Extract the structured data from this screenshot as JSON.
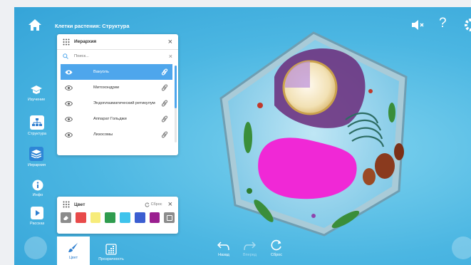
{
  "app": {
    "title": "Клетки растения: Структура"
  },
  "sidebar": {
    "items": [
      {
        "label": "Изучение",
        "icon": "graduation-cap-icon"
      },
      {
        "label": "Структура",
        "icon": "hierarchy-icon"
      },
      {
        "label": "Иерархия",
        "icon": "layers-icon"
      },
      {
        "label": "Инфо",
        "icon": "info-icon"
      },
      {
        "label": "Рассказ",
        "icon": "play-icon"
      }
    ]
  },
  "hierarchy": {
    "title": "Иерархия",
    "search_placeholder": "Поиск...",
    "items": [
      {
        "label": "Вакуоль",
        "selected": true
      },
      {
        "label": "Митохондрии",
        "selected": false
      },
      {
        "label": "Эндоплазматический ретикулум",
        "selected": false
      },
      {
        "label": "Аппарат Гольджи",
        "selected": false
      },
      {
        "label": "Лизосомы",
        "selected": false
      }
    ]
  },
  "color_panel": {
    "title": "Цвет",
    "reset_label": "Сброс",
    "swatches": [
      "#e84a4a",
      "#f7ec7a",
      "#2f9c4e",
      "#3ec3ec",
      "#3b5ed1",
      "#9a1f8f"
    ]
  },
  "bottom_toolbar": {
    "color_label": "Цвет",
    "transparency_label": "Прозрачность",
    "back_label": "Назад",
    "forward_label": "Вперед",
    "reset_label": "Сброс"
  },
  "colors": {
    "accent": "#4ea6ec",
    "background": "#4bb6e2",
    "membrane": "#f028d6"
  }
}
